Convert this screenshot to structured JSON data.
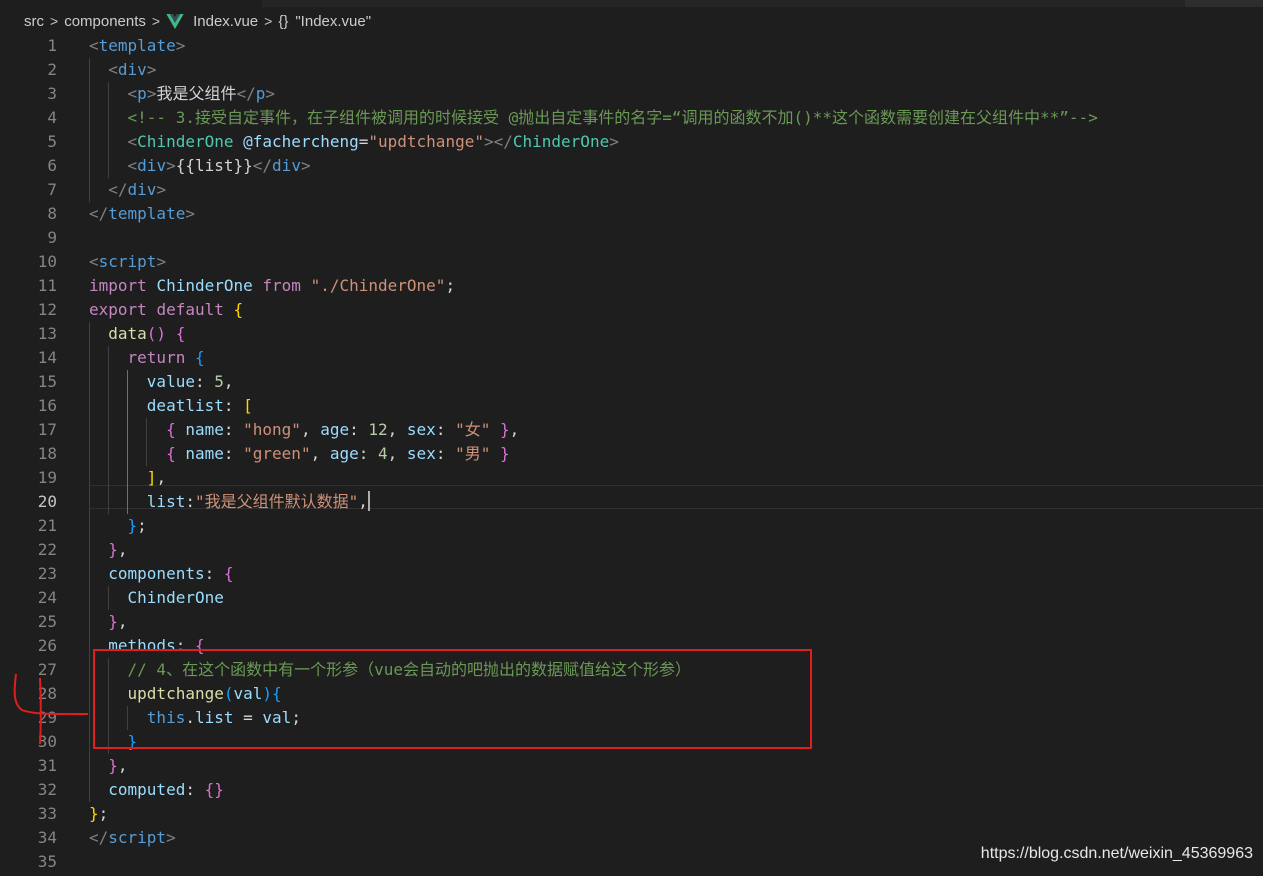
{
  "breadcrumb": {
    "items": [
      "src",
      "components",
      "Index.vue",
      "\"Index.vue\""
    ],
    "separator": ">"
  },
  "editor": {
    "active_line": 20,
    "lines": [
      {
        "n": "1",
        "tokens": [
          [
            "t-tag",
            "<"
          ],
          [
            "t-el",
            "template"
          ],
          [
            "t-tag",
            ">"
          ]
        ]
      },
      {
        "n": "2",
        "tokens": [
          [
            "t-txt",
            "  "
          ],
          [
            "t-tag",
            "<"
          ],
          [
            "t-el",
            "div"
          ],
          [
            "t-tag",
            ">"
          ]
        ]
      },
      {
        "n": "3",
        "tokens": [
          [
            "t-txt",
            "    "
          ],
          [
            "t-tag",
            "<"
          ],
          [
            "t-el",
            "p"
          ],
          [
            "t-tag",
            ">"
          ],
          [
            "t-txt",
            "我是父组件"
          ],
          [
            "t-tag",
            "</"
          ],
          [
            "t-el",
            "p"
          ],
          [
            "t-tag",
            ">"
          ]
        ]
      },
      {
        "n": "4",
        "tokens": [
          [
            "t-txt",
            "    "
          ],
          [
            "t-com",
            "<!-- 3.接受自定事件，在子组件被调用的时候接受 @抛出自定事件的名字=“调用的函数不加()**这个函数需要创建在父组件中**”-->"
          ]
        ]
      },
      {
        "n": "5",
        "tokens": [
          [
            "t-txt",
            "    "
          ],
          [
            "t-tag",
            "<"
          ],
          [
            "t-comp",
            "ChinderOne"
          ],
          [
            "t-txt",
            " "
          ],
          [
            "t-attr",
            "@fachercheng"
          ],
          [
            "t-txt",
            "="
          ],
          [
            "t-str",
            "\"updtchange\""
          ],
          [
            "t-tag",
            "></"
          ],
          [
            "t-comp",
            "ChinderOne"
          ],
          [
            "t-tag",
            ">"
          ]
        ]
      },
      {
        "n": "6",
        "tokens": [
          [
            "t-txt",
            "    "
          ],
          [
            "t-tag",
            "<"
          ],
          [
            "t-el",
            "div"
          ],
          [
            "t-tag",
            ">"
          ],
          [
            "t-txt",
            "{{list}}"
          ],
          [
            "t-tag",
            "</"
          ],
          [
            "t-el",
            "div"
          ],
          [
            "t-tag",
            ">"
          ]
        ]
      },
      {
        "n": "7",
        "tokens": [
          [
            "t-txt",
            "  "
          ],
          [
            "t-tag",
            "</"
          ],
          [
            "t-el",
            "div"
          ],
          [
            "t-tag",
            ">"
          ]
        ]
      },
      {
        "n": "8",
        "tokens": [
          [
            "t-tag",
            "</"
          ],
          [
            "t-el",
            "template"
          ],
          [
            "t-tag",
            ">"
          ]
        ]
      },
      {
        "n": "9",
        "tokens": []
      },
      {
        "n": "10",
        "tokens": [
          [
            "t-tag",
            "<"
          ],
          [
            "t-el",
            "script"
          ],
          [
            "t-tag",
            ">"
          ]
        ]
      },
      {
        "n": "11",
        "tokens": [
          [
            "t-kw",
            "import"
          ],
          [
            "t-txt",
            " "
          ],
          [
            "t-var",
            "ChinderOne"
          ],
          [
            "t-txt",
            " "
          ],
          [
            "t-kw",
            "from"
          ],
          [
            "t-txt",
            " "
          ],
          [
            "t-str",
            "\"./ChinderOne\""
          ],
          [
            "t-txt",
            ";"
          ]
        ]
      },
      {
        "n": "12",
        "tokens": [
          [
            "t-kw",
            "export"
          ],
          [
            "t-txt",
            " "
          ],
          [
            "t-kw",
            "default"
          ],
          [
            "t-txt",
            " "
          ],
          [
            "t-p1",
            "{"
          ]
        ]
      },
      {
        "n": "13",
        "tokens": [
          [
            "t-txt",
            "  "
          ],
          [
            "t-fn",
            "data"
          ],
          [
            "t-p2",
            "()"
          ],
          [
            "t-txt",
            " "
          ],
          [
            "t-p2",
            "{"
          ]
        ]
      },
      {
        "n": "14",
        "tokens": [
          [
            "t-txt",
            "    "
          ],
          [
            "t-kw",
            "return"
          ],
          [
            "t-txt",
            " "
          ],
          [
            "t-p3",
            "{"
          ]
        ]
      },
      {
        "n": "15",
        "tokens": [
          [
            "t-txt",
            "      "
          ],
          [
            "t-var",
            "value"
          ],
          [
            "t-txt",
            ": "
          ],
          [
            "t-num",
            "5"
          ],
          [
            "t-txt",
            ","
          ]
        ]
      },
      {
        "n": "16",
        "tokens": [
          [
            "t-txt",
            "      "
          ],
          [
            "t-var",
            "deatlist"
          ],
          [
            "t-txt",
            ": "
          ],
          [
            "t-p1",
            "["
          ]
        ]
      },
      {
        "n": "17",
        "tokens": [
          [
            "t-txt",
            "        "
          ],
          [
            "t-p2",
            "{"
          ],
          [
            "t-txt",
            " "
          ],
          [
            "t-var",
            "name"
          ],
          [
            "t-txt",
            ": "
          ],
          [
            "t-str",
            "\"hong\""
          ],
          [
            "t-txt",
            ", "
          ],
          [
            "t-var",
            "age"
          ],
          [
            "t-txt",
            ": "
          ],
          [
            "t-num",
            "12"
          ],
          [
            "t-txt",
            ", "
          ],
          [
            "t-var",
            "sex"
          ],
          [
            "t-txt",
            ": "
          ],
          [
            "t-str",
            "\"女\""
          ],
          [
            "t-txt",
            " "
          ],
          [
            "t-p2",
            "}"
          ],
          [
            "t-txt",
            ","
          ]
        ]
      },
      {
        "n": "18",
        "tokens": [
          [
            "t-txt",
            "        "
          ],
          [
            "t-p2",
            "{"
          ],
          [
            "t-txt",
            " "
          ],
          [
            "t-var",
            "name"
          ],
          [
            "t-txt",
            ": "
          ],
          [
            "t-str",
            "\"green\""
          ],
          [
            "t-txt",
            ", "
          ],
          [
            "t-var",
            "age"
          ],
          [
            "t-txt",
            ": "
          ],
          [
            "t-num",
            "4"
          ],
          [
            "t-txt",
            ", "
          ],
          [
            "t-var",
            "sex"
          ],
          [
            "t-txt",
            ": "
          ],
          [
            "t-str",
            "\"男\""
          ],
          [
            "t-txt",
            " "
          ],
          [
            "t-p2",
            "}"
          ]
        ]
      },
      {
        "n": "19",
        "tokens": [
          [
            "t-txt",
            "      "
          ],
          [
            "t-p1",
            "]"
          ],
          [
            "t-txt",
            ","
          ]
        ]
      },
      {
        "n": "20",
        "tokens": [
          [
            "t-txt",
            "      "
          ],
          [
            "t-var",
            "list"
          ],
          [
            "t-txt",
            ":"
          ],
          [
            "t-str",
            "\"我是父组件默认数据\""
          ],
          [
            "t-txt",
            ","
          ]
        ]
      },
      {
        "n": "21",
        "tokens": [
          [
            "t-txt",
            "    "
          ],
          [
            "t-p3",
            "}"
          ],
          [
            "t-txt",
            ";"
          ]
        ]
      },
      {
        "n": "22",
        "tokens": [
          [
            "t-txt",
            "  "
          ],
          [
            "t-p2",
            "}"
          ],
          [
            "t-txt",
            ","
          ]
        ]
      },
      {
        "n": "23",
        "tokens": [
          [
            "t-txt",
            "  "
          ],
          [
            "t-var",
            "components"
          ],
          [
            "t-txt",
            ": "
          ],
          [
            "t-p2",
            "{"
          ]
        ]
      },
      {
        "n": "24",
        "tokens": [
          [
            "t-txt",
            "    "
          ],
          [
            "t-var",
            "ChinderOne"
          ]
        ]
      },
      {
        "n": "25",
        "tokens": [
          [
            "t-txt",
            "  "
          ],
          [
            "t-p2",
            "}"
          ],
          [
            "t-txt",
            ","
          ]
        ]
      },
      {
        "n": "26",
        "tokens": [
          [
            "t-txt",
            "  "
          ],
          [
            "t-var",
            "methods"
          ],
          [
            "t-txt",
            ": "
          ],
          [
            "t-p2",
            "{"
          ]
        ]
      },
      {
        "n": "27",
        "tokens": [
          [
            "t-txt",
            "    "
          ],
          [
            "t-com",
            "// 4、在这个函数中有一个形参（vue会自动的吧抛出的数据赋值给这个形参）"
          ]
        ]
      },
      {
        "n": "28",
        "tokens": [
          [
            "t-txt",
            "    "
          ],
          [
            "t-fn",
            "updtchange"
          ],
          [
            "t-p3",
            "("
          ],
          [
            "t-var",
            "val"
          ],
          [
            "t-p3",
            ")"
          ],
          [
            "t-p3",
            "{"
          ]
        ]
      },
      {
        "n": "29",
        "tokens": [
          [
            "t-txt",
            "      "
          ],
          [
            "t-kb",
            "this"
          ],
          [
            "t-txt",
            "."
          ],
          [
            "t-var",
            "list"
          ],
          [
            "t-txt",
            " = "
          ],
          [
            "t-var",
            "val"
          ],
          [
            "t-txt",
            ";"
          ]
        ]
      },
      {
        "n": "30",
        "tokens": [
          [
            "t-txt",
            "    "
          ],
          [
            "t-p3",
            "}"
          ]
        ]
      },
      {
        "n": "31",
        "tokens": [
          [
            "t-txt",
            "  "
          ],
          [
            "t-p2",
            "}"
          ],
          [
            "t-txt",
            ","
          ]
        ]
      },
      {
        "n": "32",
        "tokens": [
          [
            "t-txt",
            "  "
          ],
          [
            "t-var",
            "computed"
          ],
          [
            "t-txt",
            ": "
          ],
          [
            "t-p2",
            "{}"
          ]
        ]
      },
      {
        "n": "33",
        "tokens": [
          [
            "t-p1",
            "}"
          ],
          [
            "t-txt",
            ";"
          ]
        ]
      },
      {
        "n": "34",
        "tokens": [
          [
            "t-tag",
            "</"
          ],
          [
            "t-el",
            "script"
          ],
          [
            "t-tag",
            ">"
          ]
        ]
      },
      {
        "n": "35",
        "tokens": []
      }
    ]
  },
  "watermark": "https://blog.csdn.net/weixin_45369963",
  "colors": {
    "background": "#1e1e1e",
    "highlight_box": "#e01e1e",
    "vue_logo_outer": "#41b883",
    "vue_logo_inner": "#35495e"
  }
}
